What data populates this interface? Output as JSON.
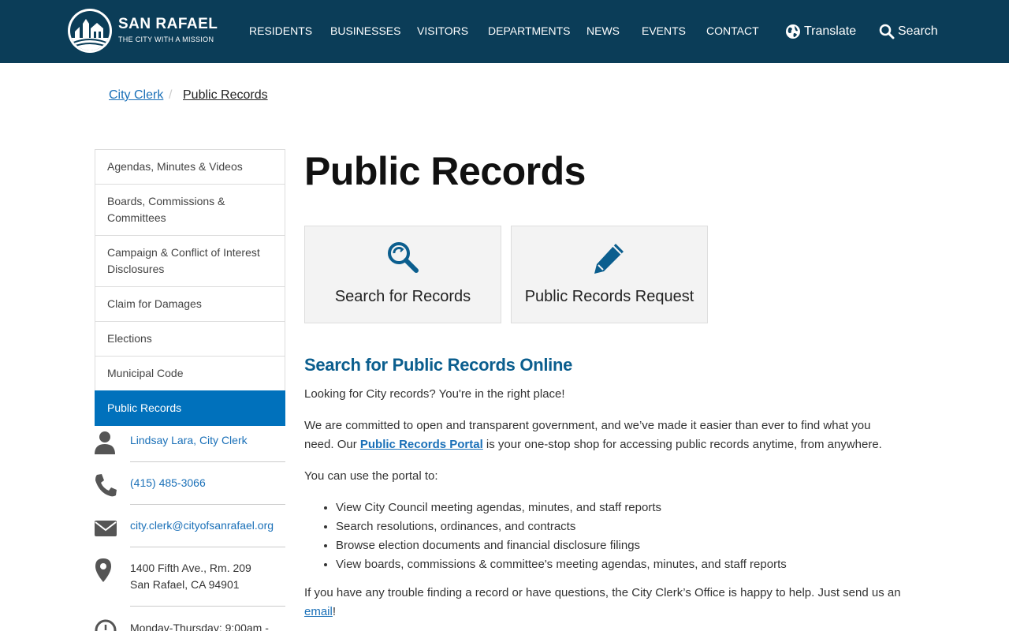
{
  "header": {
    "brand_name": "SAN RAFAEL",
    "brand_tagline": "THE CITY WITH A MISSION",
    "nav": [
      {
        "label": "RESIDENTS"
      },
      {
        "label": "BUSINESSES"
      },
      {
        "label": "VISITORS"
      },
      {
        "label": "DEPARTMENTS"
      },
      {
        "label": "NEWS"
      },
      {
        "label": "EVENTS"
      },
      {
        "label": "CONTACT"
      }
    ],
    "translate_label": "Translate",
    "search_label": "Search",
    "icons": {
      "translate": "globe-icon",
      "search": "search-icon"
    }
  },
  "breadcrumb": {
    "parent": "City Clerk",
    "separator": "/",
    "current": "Public Records"
  },
  "sidebar": {
    "items": [
      {
        "label": "Agendas, Minutes & Videos",
        "active": false
      },
      {
        "label": "Boards, Commissions & Committees",
        "active": false
      },
      {
        "label": "Campaign & Conflict of Interest Disclosures",
        "active": false
      },
      {
        "label": "Claim for Damages",
        "active": false
      },
      {
        "label": "Elections",
        "active": false
      },
      {
        "label": "Municipal Code",
        "active": false
      },
      {
        "label": "Public Records",
        "active": true
      }
    ],
    "contact": {
      "person": "Lindsay Lara, City Clerk",
      "phone": "(415) 485-3066",
      "email": "city.clerk@cityofsanrafael.org",
      "address_line1": "1400 Fifth Ave., Rm. 209",
      "address_line2": "San Rafael, CA 94901",
      "hours": "Monday-Thursday: 9:00am -"
    }
  },
  "main": {
    "title": "Public Records",
    "cards": [
      {
        "label": "Search for Records",
        "icon": "search-records-icon"
      },
      {
        "label": "Public Records Request",
        "icon": "pencil-icon"
      }
    ],
    "section_heading": "Search for Public Records Online",
    "intro": "Looking for City records? You're in the right place!",
    "para2_before": "We are committed to open and transparent government, and we’ve made it easier than ever to find what you need. Our ",
    "para2_link": "Public Records Portal",
    "para2_after": " is your one-stop shop for accessing public records anytime, from anywhere.",
    "portal_intro": "You can use the portal to:",
    "bullets": [
      "View City Council meeting agendas, minutes, and staff reports",
      "Search resolutions, ordinances, and contracts",
      "Browse election documents and financial disclosure filings",
      "View boards, commissions & committee's meeting agendas, minutes, and staff reports"
    ],
    "closing_before": "If you have any trouble finding a record or have questions, the City Clerk’s Office is happy to help. Just send us an ",
    "closing_link": "email",
    "closing_after": "!"
  },
  "colors": {
    "header_bg": "#0b3d58",
    "active_nav": "#0071bc",
    "link": "#1a70b8",
    "section_heading": "#0b5e8e",
    "icon_blue": "#0b5e8e",
    "contact_icon": "#555555"
  }
}
